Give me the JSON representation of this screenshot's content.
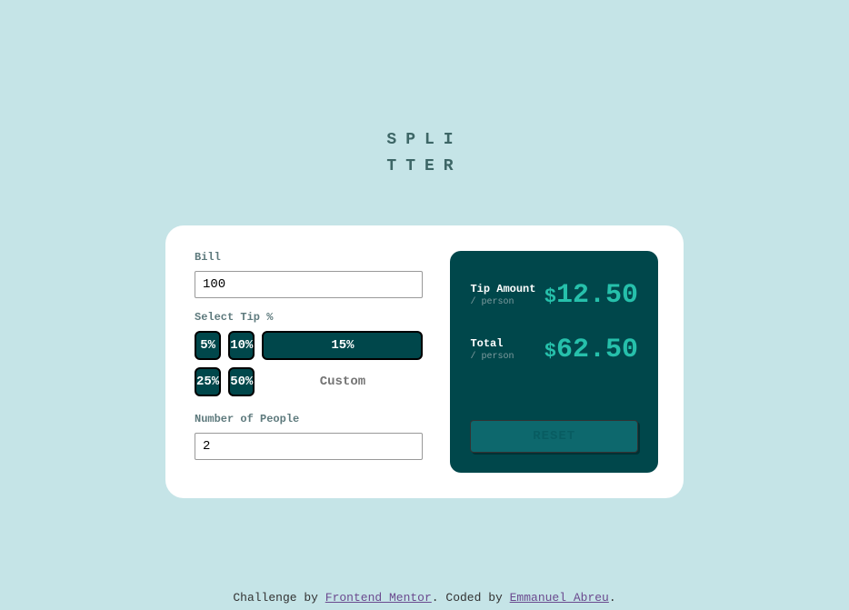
{
  "logo": {
    "line1": "SPLI",
    "line2": "TTER"
  },
  "left": {
    "bill_label": "Bill",
    "bill_value": "100",
    "tip_label": "Select Tip %",
    "tips": [
      "5%",
      "10%",
      "15%",
      "25%",
      "50%"
    ],
    "custom_placeholder": "Custom",
    "people_label": "Number of People",
    "people_value": "2"
  },
  "right": {
    "tip_amount_label": "Tip Amount",
    "per_person_label": "/ person",
    "tip_amount_value": "12.50",
    "total_label": "Total",
    "total_value": "62.50",
    "reset_label": "RESET"
  },
  "attribution": {
    "prefix": "Challenge by ",
    "link1": "Frontend Mentor",
    "mid": ". Coded by ",
    "link2": "Emmanuel Abreu",
    "suffix": "."
  }
}
